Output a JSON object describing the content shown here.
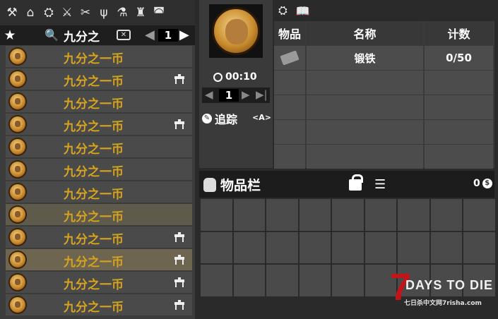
{
  "categories": [
    {
      "name": "hammer-icon",
      "glyph": "⚒"
    },
    {
      "name": "house-icon",
      "glyph": "⌂"
    },
    {
      "name": "workbench-icon",
      "glyph": "⛭"
    },
    {
      "name": "sword-icon",
      "glyph": "⚔"
    },
    {
      "name": "tools-icon",
      "glyph": "✂"
    },
    {
      "name": "fork-icon",
      "glyph": "ψ"
    },
    {
      "name": "science-icon",
      "glyph": "⚗"
    },
    {
      "name": "armor-icon",
      "glyph": "♜"
    },
    {
      "name": "helmet-icon",
      "glyph": "◚"
    }
  ],
  "search": {
    "favorite_glyph": "★",
    "search_glyph": "🔍",
    "value": "九分之",
    "clear_glyph": "✕",
    "page_prev": "◀",
    "page": "1",
    "page_next": "▶"
  },
  "recipes": [
    {
      "label": "九分之一币",
      "workbench": false,
      "state": "normal"
    },
    {
      "label": "九分之一币",
      "workbench": true,
      "state": "normal"
    },
    {
      "label": "九分之一币",
      "workbench": false,
      "state": "normal"
    },
    {
      "label": "九分之一币",
      "workbench": true,
      "state": "normal"
    },
    {
      "label": "九分之一币",
      "workbench": false,
      "state": "normal"
    },
    {
      "label": "九分之一币",
      "workbench": false,
      "state": "normal"
    },
    {
      "label": "九分之一币",
      "workbench": false,
      "state": "normal"
    },
    {
      "label": "九分之一币",
      "workbench": false,
      "state": "hl"
    },
    {
      "label": "九分之一币",
      "workbench": true,
      "state": "normal"
    },
    {
      "label": "九分之一币",
      "workbench": true,
      "state": "hl2"
    },
    {
      "label": "九分之一币",
      "workbench": true,
      "state": "normal"
    },
    {
      "label": "九分之一币",
      "workbench": true,
      "state": "normal"
    }
  ],
  "craft": {
    "timer": "00:10",
    "quantity": "1",
    "qty_prev": "◀",
    "qty_next": "▶",
    "qty_max": "▶|",
    "track_label": "追踪",
    "track_key": "<A>"
  },
  "ingredients": {
    "headers": {
      "item": "物品",
      "name": "名称",
      "count": "计数"
    },
    "rows": [
      {
        "name": "锻铁",
        "count": "0/50"
      },
      {
        "name": "",
        "count": ""
      },
      {
        "name": "",
        "count": ""
      },
      {
        "name": "",
        "count": ""
      },
      {
        "name": "",
        "count": ""
      }
    ]
  },
  "inventory": {
    "title": "物品栏",
    "coins": "0",
    "coin_symbol": "$",
    "slots": 27
  },
  "watermark": {
    "seven": "7",
    "title": "DAYS TO DIE",
    "subtitle": "七日杀中文网7risha.com"
  }
}
